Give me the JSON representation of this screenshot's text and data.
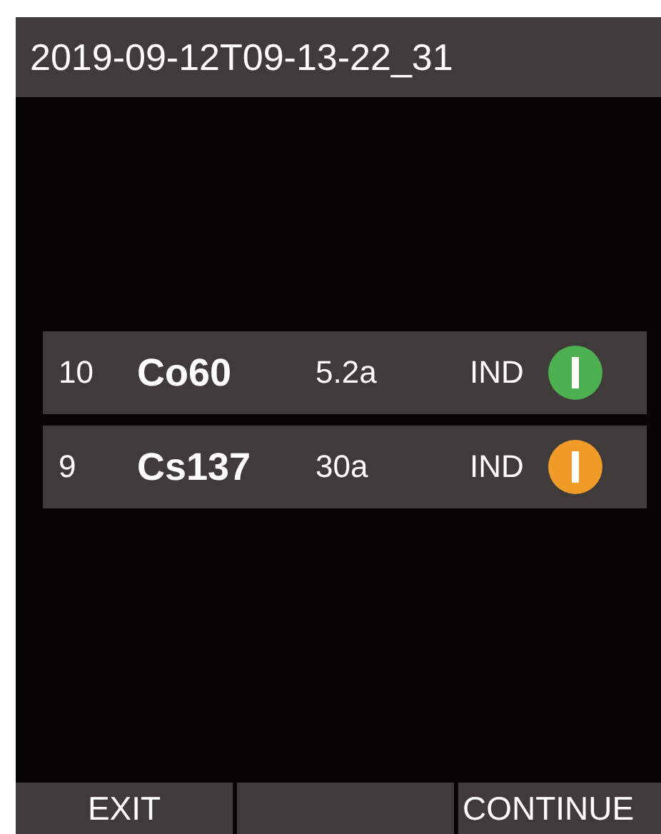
{
  "title": "2019-09-12T09-13-22_31",
  "sources": [
    {
      "number": "10",
      "nuclide": "Co60",
      "half_life": "5.2a",
      "type": "IND",
      "color": "#4caf50"
    },
    {
      "number": "9",
      "nuclide": "Cs137",
      "half_life": "30a",
      "type": "IND",
      "color": "#f09a28"
    }
  ],
  "softkeys": [
    {
      "kind": "label",
      "label": "EXIT"
    },
    {
      "kind": "blank"
    },
    {
      "kind": "label",
      "label": "CONTINUE"
    }
  ]
}
